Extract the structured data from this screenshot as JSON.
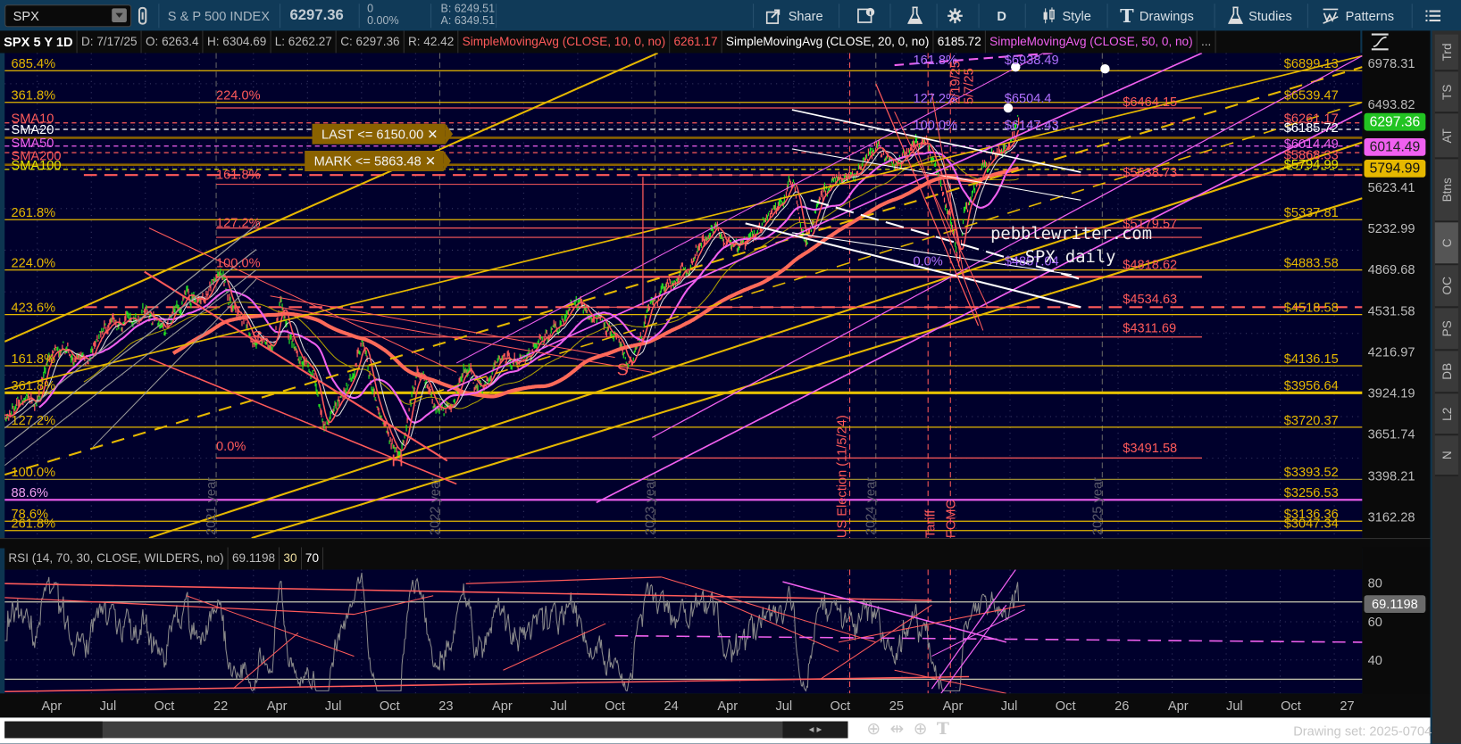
{
  "toolbar": {
    "symbol": "SPX",
    "description": "S & P 500 INDEX",
    "last": "6297.36",
    "change": "0",
    "change_pct": "0.00%",
    "bid": "B: 6249.51",
    "ask": "A: 6349.51",
    "share_label": "Share",
    "aggregation_label": "D",
    "style_label": "Style",
    "drawings_label": "Drawings",
    "studies_label": "Studies",
    "patterns_label": "Patterns"
  },
  "info": {
    "title": "SPX 5 Y 1D",
    "date": "D: 7/17/25",
    "open": "O: 6263.4",
    "high": "H: 6304.69",
    "low": "L: 6262.27",
    "close": "C: 6297.36",
    "range": "R: 42.42",
    "sma10": "SimpleMovingAvg (CLOSE, 10, 0, no)",
    "sma10_value": "6261.17",
    "sma20": "SimpleMovingAvg (CLOSE, 20, 0, no)",
    "sma20_value": "6185.72",
    "sma50": "SimpleMovingAvg (CLOSE, 50, 0, no)",
    "more": "..."
  },
  "price_axis": {
    "ticks": [
      "6978.31",
      "6493.82",
      "5623.41",
      "5232.99",
      "4869.68",
      "4531.58",
      "4216.97",
      "3924.19",
      "3651.74",
      "3398.21",
      "3162.28"
    ],
    "badges": [
      {
        "text": "6297.36",
        "bg": "#22c322",
        "fg": "#ffffff"
      },
      {
        "text": "6014.49",
        "bg": "#f060f0",
        "fg": "#222222"
      },
      {
        "text": "5794.99",
        "bg": "#e6b800",
        "fg": "#111111"
      }
    ]
  },
  "side_tabs": [
    "Trd",
    "TS",
    "AT",
    "Btns",
    "C",
    "OC",
    "PS",
    "DB",
    "L2",
    "N"
  ],
  "active_side_tab": "C",
  "fib_left": [
    "685.4%",
    "361.8%",
    "261.8%",
    "224.0%",
    "423.6%",
    "161.8%",
    "361.8%",
    "127.2%",
    "100.0%",
    "88.6%",
    "78.6%",
    "261.8%"
  ],
  "fib_right_yellow": [
    "$6899.13",
    "$6539.47",
    "$5337.81",
    "$4883.58",
    "$4518.58",
    "$4136.15",
    "$3956.64",
    "$3720.37",
    "$3393.52",
    "$3256.53",
    "$3136.36",
    "$3047.34"
  ],
  "sma_right": [
    {
      "text": "$6261.17",
      "color": "#ff5a5a"
    },
    {
      "text": "$6185.72",
      "color": "#ffffff"
    },
    {
      "text": "$6014.49",
      "color": "#f060f0"
    },
    {
      "text": "$5868.33",
      "color": "#ff5a5a"
    },
    {
      "text": "$5794.99",
      "color": "#e6e600"
    }
  ],
  "fib_red_left": [
    "224.0%",
    "161.8%",
    "127.2%",
    "100.0%",
    "0.0%"
  ],
  "fib_red_right": [
    "$6464.15",
    "$5638.73",
    "$5179.57",
    "$4818.62",
    "$4534.63",
    "$4311.69",
    "$3491.58"
  ],
  "fib_purple": [
    {
      "pct": "161.8%",
      "price": "$6938.49"
    },
    {
      "pct": "127.2%",
      "price": "$6504.4"
    },
    {
      "pct": "100.0%",
      "price": "$6147.43"
    },
    {
      "pct": "0.0%",
      "price": "$4857.04"
    }
  ],
  "sma_tags": [
    {
      "text": "SMA10",
      "color": "#ff5a5a"
    },
    {
      "text": "SMA20",
      "color": "#ffffff"
    },
    {
      "text": "SMA50",
      "color": "#f060f0"
    },
    {
      "text": "SMA200",
      "color": "#ff5a5a"
    },
    {
      "text": "SMA100",
      "color": "#e6e600"
    }
  ],
  "alerts": [
    "LAST <= 6150.00",
    "MARK <= 5863.48"
  ],
  "alert_close": "✕",
  "watermark": [
    "pebblewriter.com",
    "SPX daily"
  ],
  "events": [
    "US Election (11/5/24)",
    "Tariff",
    "FOMC",
    "2/19/25",
    "5/7/25"
  ],
  "year_markers": [
    "2021 year",
    "2022 year",
    "2023 year",
    "2024 year",
    "2025 year"
  ],
  "pattern_marks": [
    "S",
    "S",
    "H"
  ],
  "rsi": {
    "title": "RSI (14, 70, 30, CLOSE, WILDERS, no)",
    "value": "69.1198",
    "oversold": "30",
    "overbought": "70",
    "ticks": [
      "80",
      "60",
      "40"
    ]
  },
  "x_axis": [
    "Apr",
    "Jul",
    "Oct",
    "22",
    "Apr",
    "Jul",
    "Oct",
    "23",
    "Apr",
    "Jul",
    "Oct",
    "24",
    "Apr",
    "Jul",
    "Oct",
    "25",
    "Apr",
    "Jul",
    "Oct",
    "26",
    "Apr",
    "Jul",
    "Oct",
    "27"
  ],
  "footer": {
    "drawing_set": "Drawing set: 2025-0704"
  },
  "colors": {
    "background": "#00002c",
    "fib_yellow": "#e6b800",
    "red": "#ff5a5a",
    "pink": "#f060f0",
    "up": "#22dd22"
  },
  "price_path_months_since_jan2021": [
    [
      0,
      3750
    ],
    [
      1,
      3800
    ],
    [
      2,
      3900
    ],
    [
      3,
      4150
    ],
    [
      4,
      4180
    ],
    [
      5,
      4200
    ],
    [
      6,
      4380
    ],
    [
      7,
      4450
    ],
    [
      8,
      4520
    ],
    [
      9,
      4350
    ],
    [
      10,
      4600
    ],
    [
      11,
      4700
    ],
    [
      12,
      4790
    ],
    [
      13,
      4450
    ],
    [
      14,
      4300
    ],
    [
      14.7,
      4200
    ],
    [
      15.2,
      4550
    ],
    [
      16,
      4200
    ],
    [
      17,
      4050
    ],
    [
      17.5,
      3700
    ],
    [
      18.5,
      3900
    ],
    [
      19.5,
      4300
    ],
    [
      20.5,
      3700
    ],
    [
      21.3,
      3550
    ],
    [
      21.8,
      3600
    ],
    [
      22.5,
      4050
    ],
    [
      23.3,
      3850
    ],
    [
      24,
      3850
    ],
    [
      25,
      4100
    ],
    [
      26,
      3950
    ],
    [
      27,
      4150
    ],
    [
      28,
      4170
    ],
    [
      29,
      4300
    ],
    [
      30,
      4450
    ],
    [
      30.9,
      4590
    ],
    [
      32,
      4450
    ],
    [
      33,
      4300
    ],
    [
      33.9,
      4120
    ],
    [
      35,
      4560
    ],
    [
      36,
      4750
    ],
    [
      37,
      4900
    ],
    [
      38.3,
      5200
    ],
    [
      39,
      5200
    ],
    [
      39.6,
      4970
    ],
    [
      41,
      5300
    ],
    [
      42.5,
      5650
    ],
    [
      43.2,
      5200
    ],
    [
      44,
      5600
    ],
    [
      45,
      5700
    ],
    [
      46,
      5800
    ],
    [
      47,
      6050
    ],
    [
      47.5,
      5880
    ],
    [
      48,
      5850
    ],
    [
      49,
      6100
    ],
    [
      49.6,
      6120
    ],
    [
      50.5,
      5600
    ],
    [
      51.3,
      4980
    ],
    [
      51.6,
      5400
    ],
    [
      52.2,
      5600
    ],
    [
      53,
      5900
    ],
    [
      53.5,
      6000
    ],
    [
      54,
      6200
    ],
    [
      54.5,
      6297.36
    ]
  ]
}
